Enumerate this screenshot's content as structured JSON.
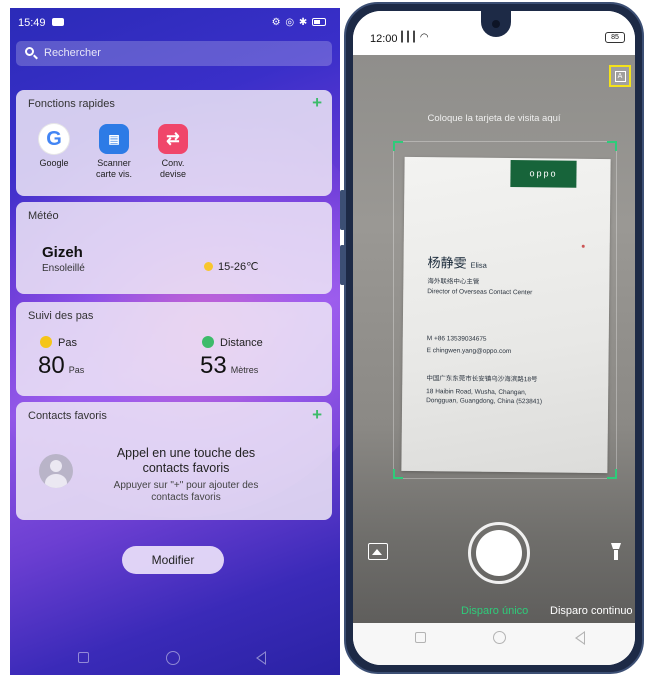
{
  "left": {
    "status": {
      "time": "15:49",
      "icons": "⚙ ◎ ✱"
    },
    "search": {
      "placeholder": "Rechercher"
    },
    "quick": {
      "title": "Fonctions rapides",
      "apps": [
        {
          "label": "Google",
          "icon": "G"
        },
        {
          "label": "Scanner\ncarte vis.",
          "line1": "Scanner",
          "line2": "carte vis.",
          "icon": "▤"
        },
        {
          "label": "Conv.\ndevise",
          "line1": "Conv.",
          "line2": "devise",
          "icon": "⇄"
        }
      ]
    },
    "meteo": {
      "title": "Météo",
      "city": "Gizeh",
      "condition": "Ensoleillé",
      "temperature": "15-26℃"
    },
    "steps": {
      "title": "Suivi des pas",
      "pas_label": "Pas",
      "pas_value": "80",
      "pas_unit": "Pas",
      "dist_label": "Distance",
      "dist_value": "53",
      "dist_unit": "Mètres",
      "pas_color": "#f5c518",
      "dist_color": "#3dbb6a"
    },
    "contacts": {
      "title": "Contacts favoris",
      "main_line1": "Appel en une touche des",
      "main_line2": "contacts favoris",
      "sub_line1": "Appuyer sur \"+\" pour ajouter des",
      "sub_line2": "contacts favoris"
    },
    "modify_button": "Modifier"
  },
  "right": {
    "status": {
      "time": "12:00",
      "signal": "┃┃┃ ◠",
      "battery": "85"
    },
    "hint": "Coloque la tarjeta de visita aquí",
    "auto_button": "A",
    "card": {
      "brand": "oppo",
      "name_cn": "杨静雯",
      "name_en": "Elisa",
      "title_cn": "海外联络中心主管",
      "title_en": "Director of Overseas Contact Center",
      "phone": "M  +86 13539034675",
      "email": "E   chingwen.yang@oppo.com",
      "addr_cn": "中国广东东莞市长安镇乌沙海滨路18号",
      "addr_en1": "18 Haibin Road, Wusha, Changan,",
      "addr_en2": "Dongguan, Guangdong, China (523841)"
    },
    "mode_single": "Disparo único",
    "mode_continuous": "Disparo continuo",
    "accent_color": "#2ecc7a",
    "highlight_color": "#f4e21a"
  }
}
